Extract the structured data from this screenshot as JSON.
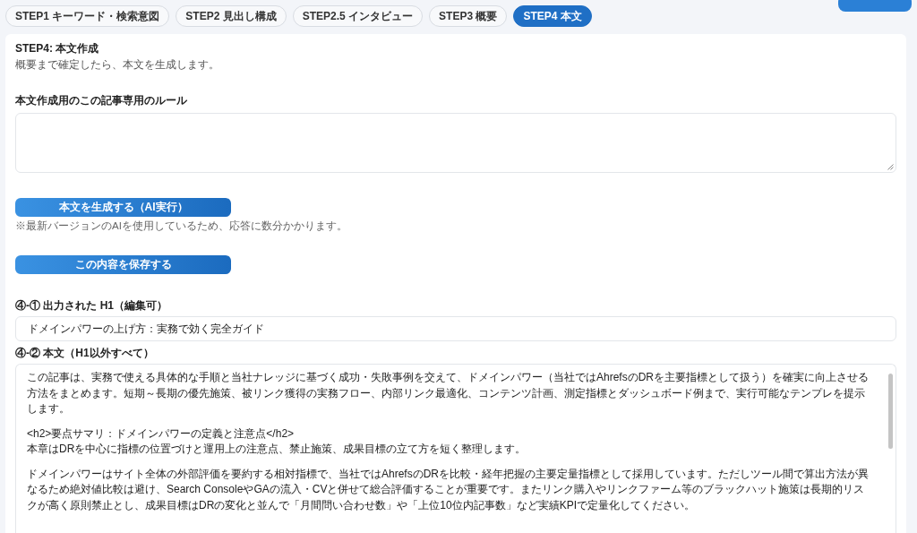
{
  "tabs": [
    {
      "label": "STEP1 キーワード・検索意図",
      "selected": false
    },
    {
      "label": "STEP2 見出し構成",
      "selected": false
    },
    {
      "label": "STEP2.5 インタビュー",
      "selected": false
    },
    {
      "label": "STEP3 概要",
      "selected": false
    },
    {
      "label": "STEP4 本文",
      "selected": true
    }
  ],
  "step": {
    "title": "STEP4: 本文作成",
    "description": "概要まで確定したら、本文を生成します。"
  },
  "rules": {
    "label": "本文作成用のこの記事専用のルール"
  },
  "generate_button": {
    "label": "本文を生成する（AI実行）",
    "note": "※最新バージョンのAIを使用しているため、応答に数分かかります。"
  },
  "save_button": {
    "label": "この内容を保存する"
  },
  "h1": {
    "label": "④-① 出力された H1（編集可）",
    "value": "ドメインパワーの上げ方：実務で効く完全ガイド"
  },
  "body": {
    "label": "④-② 本文（H1以外すべて）",
    "blocks": [
      {
        "lines": [
          "この記事は、実務で使える具体的な手順と当社ナレッジに基づく成功・失敗事例を交えて、ドメインパワー（当社ではAhrefsのDRを主要指標として扱う）を確実に向上させる方法をまとめます。短期～長期の優先施策、被リンク獲得の実務フロー、内部リンク最適化、コンテンツ計画、測定指標とダッシュボード例まで、実行可能なテンプレを提示します。"
        ]
      },
      {
        "lines": [
          "<h2>要点サマリ：ドメインパワーの定義と注意点</h2>",
          "本章はDRを中心に指標の位置づけと運用上の注意点、禁止施策、成果目標の立て方を短く整理します。"
        ]
      },
      {
        "lines": [
          "ドメインパワーはサイト全体の外部評価を要約する相対指標で、当社ではAhrefsのDRを比較・経年把握の主要定量指標として採用しています。ただしツール間で算出方法が異なるため絶対値比較は避け、Search ConsoleやGAの流入・CVと併せて総合評価することが重要です。またリンク購入やリンクファーム等のブラックハット施策は長期的リスクが高く原則禁止とし、成果目標はDRの変化と並んで「月間問い合わせ数」や「上位10位内記事数」など実績KPIで定量化してください。"
        ]
      }
    ]
  }
}
